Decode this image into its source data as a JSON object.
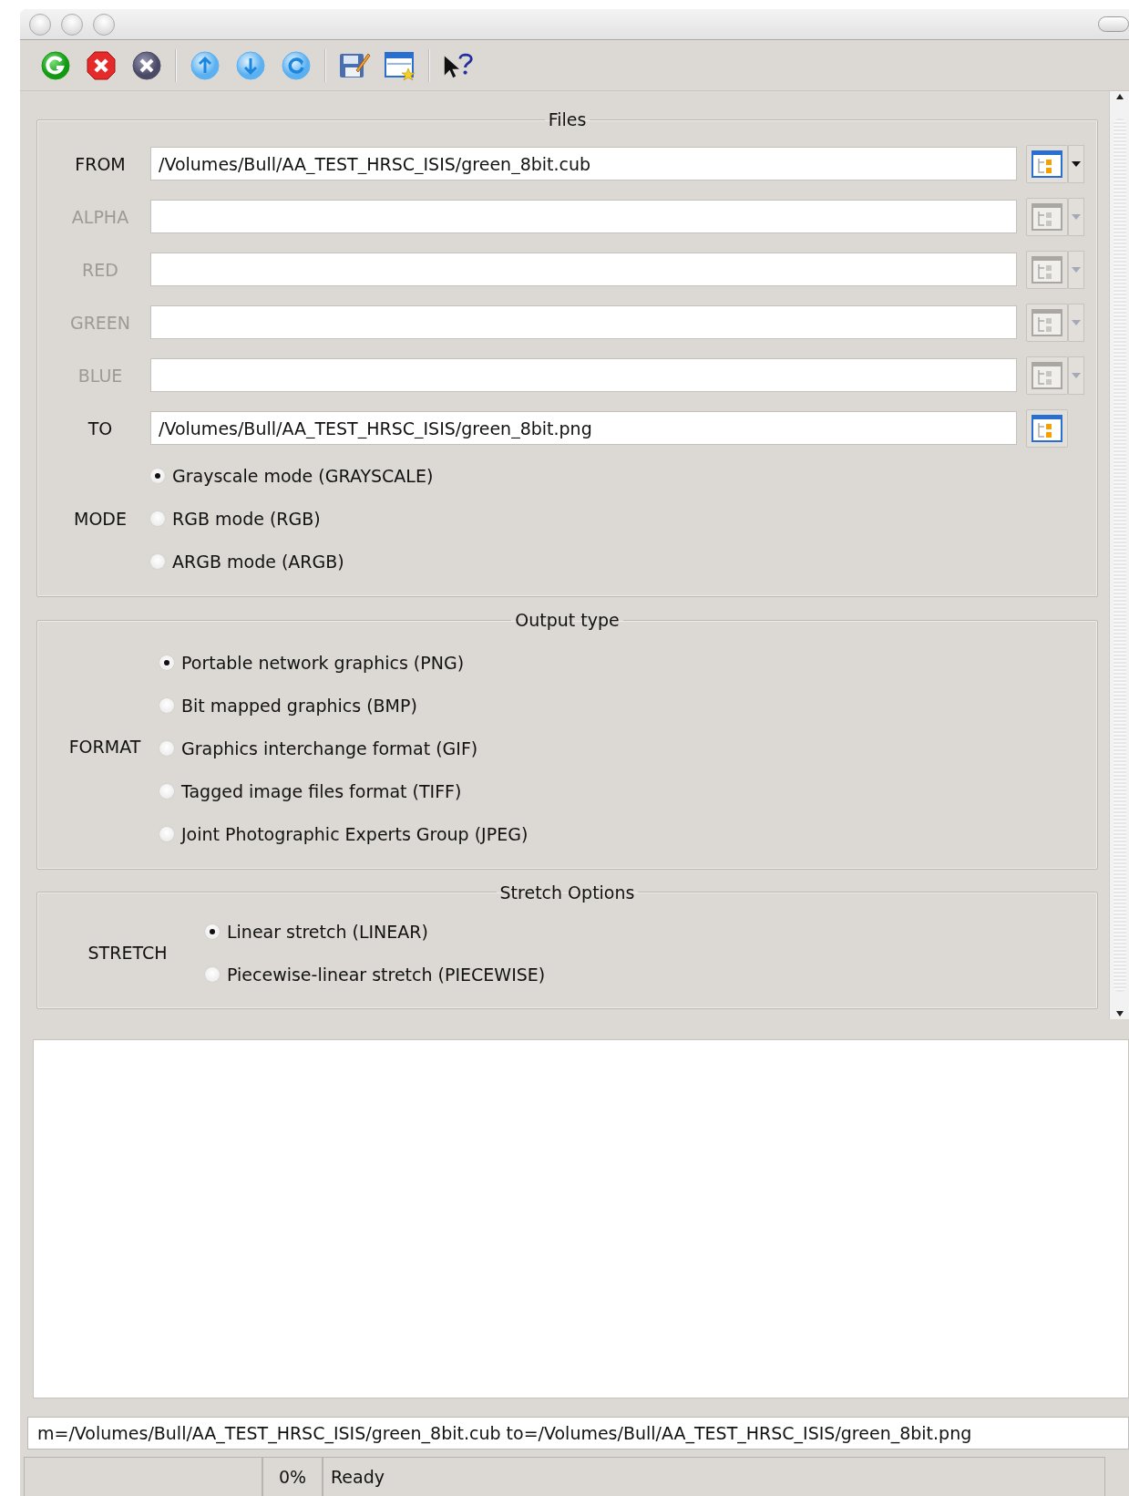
{
  "files": {
    "title": "Files",
    "fields": [
      {
        "label": "FROM",
        "value": "/Volumes/Bull/AA_TEST_HRSC_ISIS/green_8bit.cub",
        "disabled": false,
        "has_menu": true
      },
      {
        "label": "ALPHA",
        "disabled": true,
        "has_menu": true
      },
      {
        "label": "RED",
        "disabled": true,
        "has_menu": true
      },
      {
        "label": "GREEN",
        "disabled": true,
        "has_menu": true
      },
      {
        "label": "BLUE",
        "disabled": true,
        "has_menu": true
      },
      {
        "label": "TO",
        "value": "/Volumes/Bull/AA_TEST_HRSC_ISIS/green_8bit.png",
        "disabled": false,
        "has_menu": false
      }
    ],
    "choice": {
      "label": "MODE",
      "options": [
        {
          "label": "Grayscale mode (GRAYSCALE)",
          "selected": true
        },
        {
          "label": "RGB mode (RGB)",
          "selected": false
        },
        {
          "label": "ARGB mode (ARGB)",
          "selected": false
        }
      ]
    }
  },
  "output_type": {
    "title": "Output type",
    "choice": {
      "label": "FORMAT",
      "options": [
        {
          "label": "Portable network graphics (PNG)",
          "selected": true
        },
        {
          "label": "Bit mapped graphics (BMP)",
          "selected": false
        },
        {
          "label": "Graphics interchange format (GIF)",
          "selected": false
        },
        {
          "label": "Tagged image files format (TIFF)",
          "selected": false
        },
        {
          "label": "Joint Photographic Experts Group (JPEG)",
          "selected": false
        }
      ]
    }
  },
  "stretch_options": {
    "title": "Stretch Options",
    "choice": {
      "label": "STRETCH",
      "options": [
        {
          "label": "Linear stretch (LINEAR)",
          "selected": true
        },
        {
          "label": "Piecewise-linear stretch (PIECEWISE)",
          "selected": false
        }
      ]
    }
  },
  "command_line": "m=/Volumes/Bull/AA_TEST_HRSC_ISIS/green_8bit.cub to=/Volumes/Bull/AA_TEST_HRSC_ISIS/green_8bit.png",
  "status_bar": {
    "progress": "0%",
    "message": "Ready"
  }
}
